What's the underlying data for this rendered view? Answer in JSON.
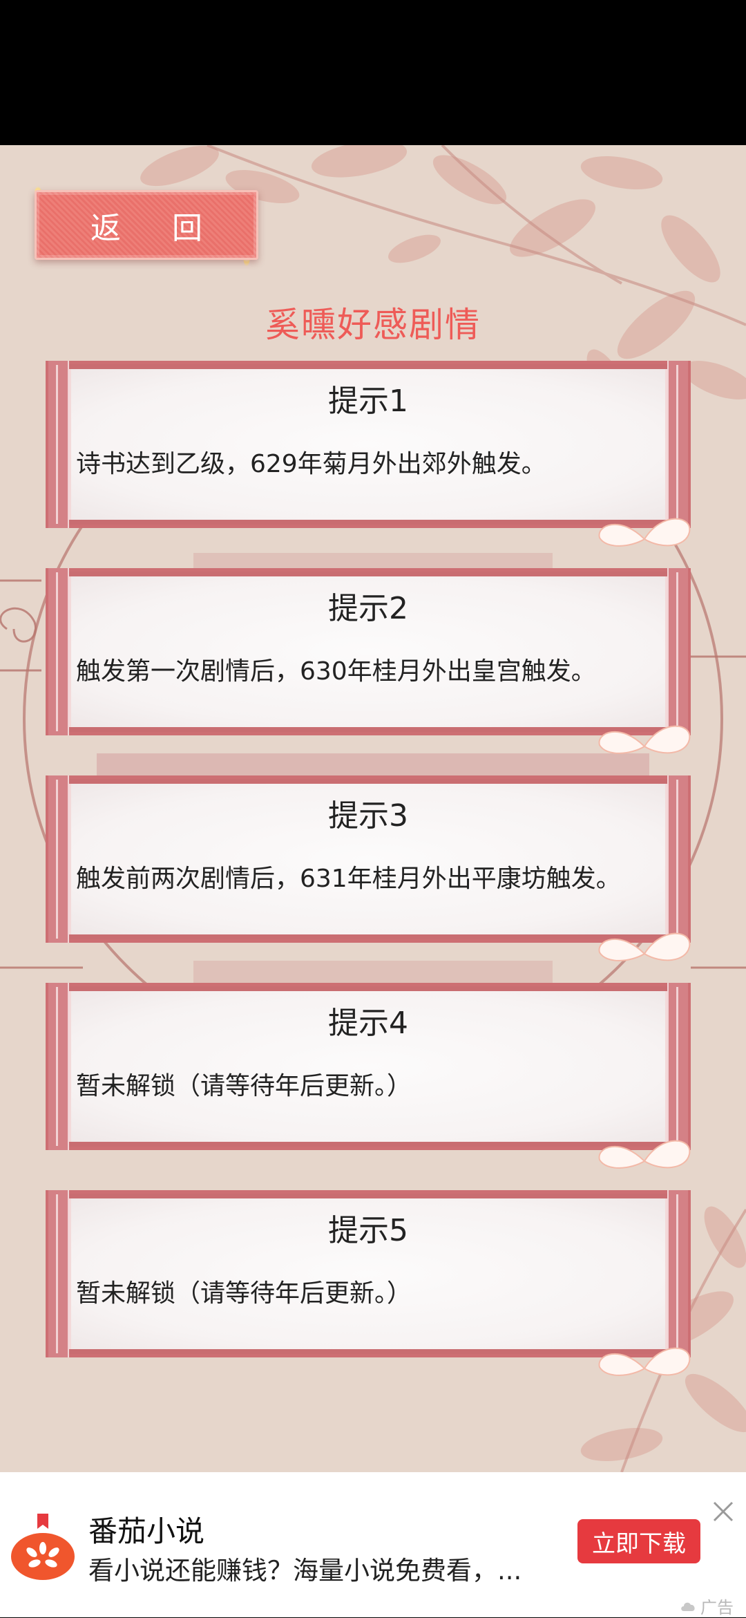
{
  "header": {
    "back_label": "返 回",
    "title": "奚曛好感剧情"
  },
  "hints": [
    {
      "title": "提示1",
      "text": "诗书达到乙级，629年菊月外出郊外触发。"
    },
    {
      "title": "提示2",
      "text": "触发第一次剧情后，630年桂月外出皇宫触发。"
    },
    {
      "title": "提示3",
      "text": "触发前两次剧情后，631年桂月外出平康坊触发。"
    },
    {
      "title": "提示4",
      "text": "暂未解锁（请等待年后更新。）"
    },
    {
      "title": "提示5",
      "text": "暂未解锁（请等待年后更新。）"
    }
  ],
  "ad": {
    "app_name": "番茄小说",
    "description": "看小说还能赚钱？海量小说免费看，...",
    "cta": "立即下载",
    "tag": "广告",
    "accent": "#e63a3f"
  },
  "icons": {
    "logo": "tomato-logo-icon",
    "close": "close-icon",
    "butterfly": "butterfly-icon",
    "cloud": "cloud-icon"
  }
}
